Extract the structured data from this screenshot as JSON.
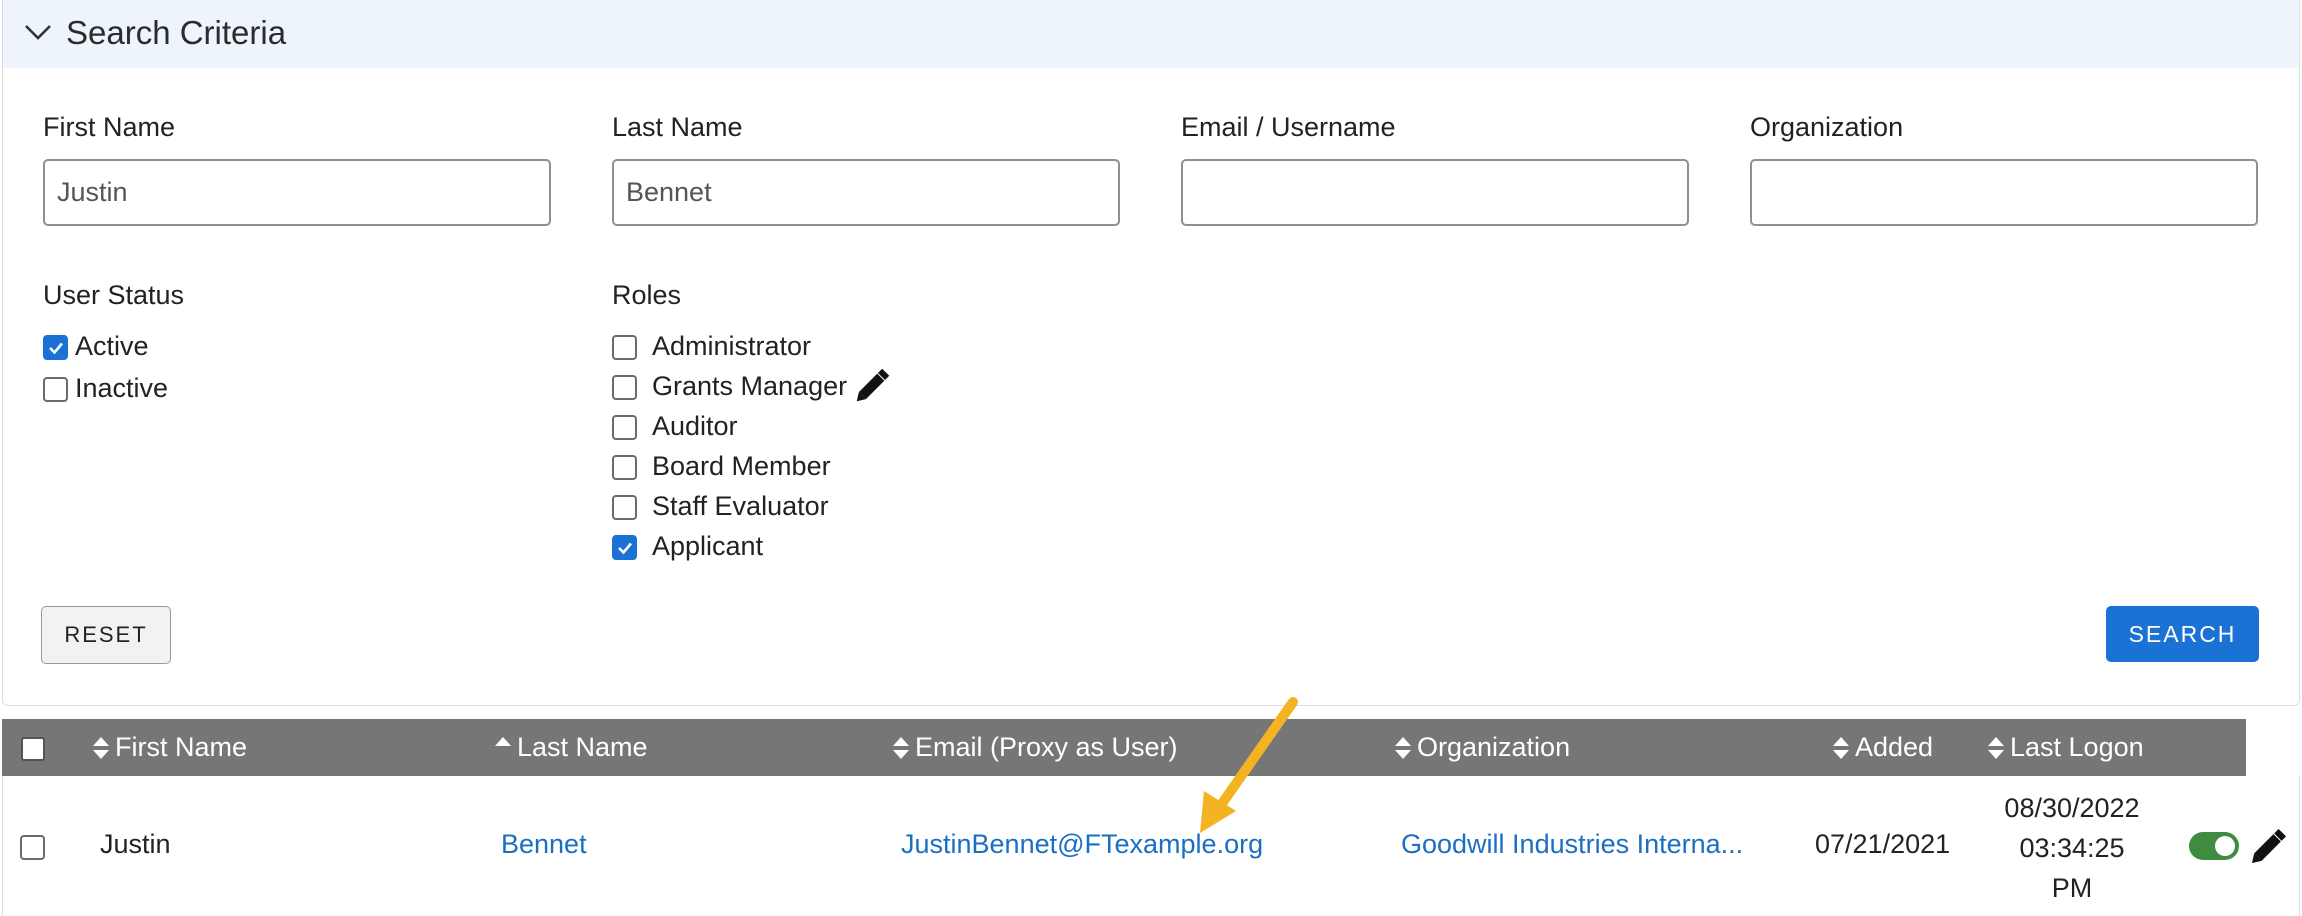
{
  "criteria": {
    "title": "Search Criteria",
    "fields": {
      "first_name": {
        "label": "First Name",
        "value": "Justin"
      },
      "last_name": {
        "label": "Last Name",
        "value": "Bennet"
      },
      "email": {
        "label": "Email / Username",
        "value": ""
      },
      "organization": {
        "label": "Organization",
        "value": ""
      }
    },
    "user_status": {
      "label": "User Status",
      "options": [
        {
          "label": "Active",
          "checked": true
        },
        {
          "label": "Inactive",
          "checked": false
        }
      ]
    },
    "roles": {
      "label": "Roles",
      "options": [
        {
          "label": "Administrator",
          "checked": false
        },
        {
          "label": "Grants Manager",
          "checked": false
        },
        {
          "label": "Auditor",
          "checked": false
        },
        {
          "label": "Board Member",
          "checked": false
        },
        {
          "label": "Staff Evaluator",
          "checked": false
        },
        {
          "label": "Applicant",
          "checked": true
        }
      ]
    },
    "reset_label": "RESET",
    "search_label": "SEARCH"
  },
  "table": {
    "columns": {
      "first_name": "First Name",
      "last_name": "Last Name",
      "email": "Email (Proxy as User)",
      "organization": "Organization",
      "added": "Added",
      "last_logon": "Last Logon"
    },
    "rows": [
      {
        "first_name": "Justin",
        "last_name": "Bennet",
        "email": "JustinBennet@FTexample.org",
        "organization": "Goodwill Industries Interna...",
        "added": "07/21/2021",
        "last_logon_date": "08/30/2022",
        "last_logon_time": "03:34:25",
        "last_logon_ampm": "PM",
        "active": true
      }
    ]
  },
  "colors": {
    "accent": "#1a73d4",
    "header_bg": "#767676",
    "panel_header_bg": "#eef4fc",
    "link": "#1a6fc4",
    "toggle_on": "#3f8b3f",
    "annotation_arrow": "#f4b323"
  },
  "icons": [
    "chevron-down-icon",
    "pencil-icon",
    "sort-icon",
    "sort-up-icon",
    "toggle-switch",
    "arrow-annotation"
  ]
}
